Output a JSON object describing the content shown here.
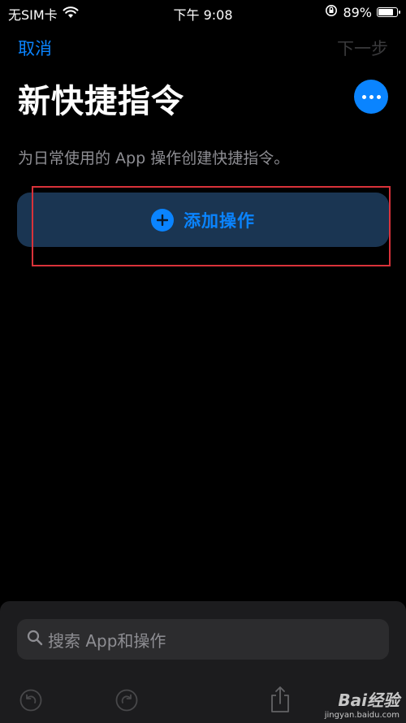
{
  "status_bar": {
    "carrier": "无SIM卡",
    "time": "下午 9:08",
    "battery_percent": "89%",
    "battery_level": 0.89
  },
  "nav": {
    "cancel": "取消",
    "next": "下一步"
  },
  "title": "新快捷指令",
  "subtitle": "为日常使用的 App 操作创建快捷指令。",
  "add_action": {
    "label": "添加操作"
  },
  "search": {
    "placeholder": "搜索 App和操作"
  },
  "toolbar": {
    "icons": [
      "undo-icon",
      "redo-icon",
      "share-icon"
    ]
  },
  "watermark": {
    "brand": "Bai经验",
    "url": "jingyan.baidu.com"
  },
  "colors": {
    "accent": "#0a84ff",
    "background": "#000000",
    "button_bg": "#1a3552",
    "highlight": "#d9323a"
  }
}
